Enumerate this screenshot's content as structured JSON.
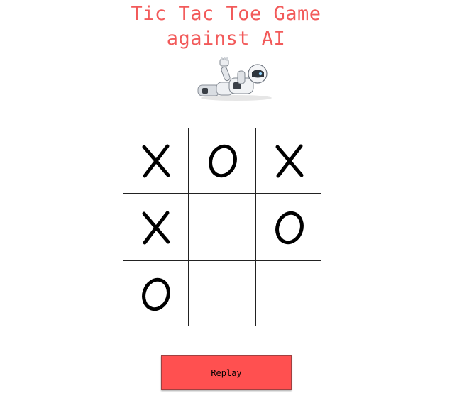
{
  "title": {
    "line1": "Tic Tac Toe Game",
    "line2": "against AI",
    "color": "#f25a5a"
  },
  "board": {
    "cells": [
      "X",
      "O",
      "X",
      "X",
      "",
      "O",
      "O",
      "",
      ""
    ]
  },
  "replay_button": {
    "label": "Replay",
    "color": "#ff5050"
  }
}
